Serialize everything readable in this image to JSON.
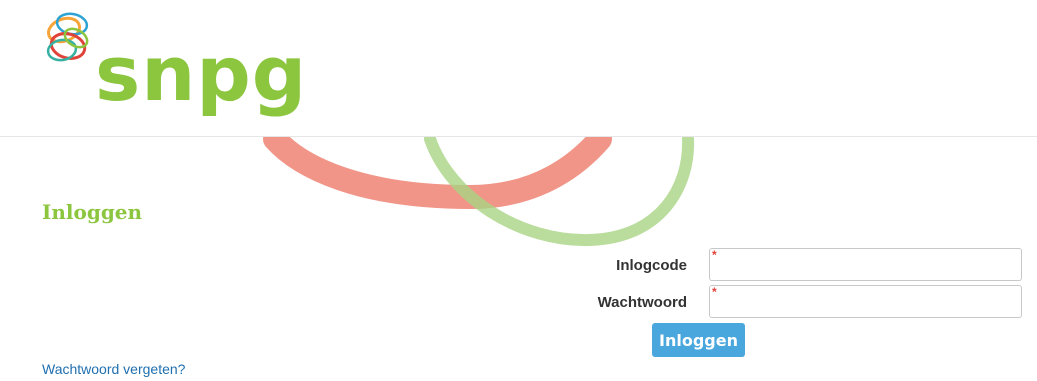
{
  "brand": {
    "logo_text": "snpg",
    "colors": {
      "green": "#8cc63f",
      "red": "#e0433a",
      "orange": "#f7a53a",
      "blue": "#2ea3d3",
      "teal": "#36b0a0"
    }
  },
  "login": {
    "title": "Inloggen",
    "fields": {
      "code_label": "Inlogcode",
      "password_label": "Wachtwoord",
      "required_marker": "*"
    },
    "submit_label": "Inloggen",
    "forgot_link": "Wachtwoord vergeten?",
    "button_color": "#4aa7de",
    "link_color": "#1f6fb0"
  }
}
